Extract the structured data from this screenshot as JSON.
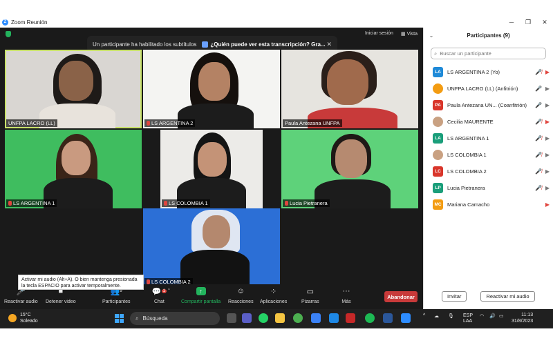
{
  "window": {
    "title": "Zoom Reunión"
  },
  "top_right": {
    "signin": "Iniciar sesión",
    "view": "Vista"
  },
  "banner": {
    "message": "Un participante ha habilitado los subtítulos",
    "link": "¿Quién puede ver esta transcripción? Gra..."
  },
  "tiles": [
    {
      "name": "UNFPA LACRO (LL)"
    },
    {
      "name": "LS ARGENTINA 2"
    },
    {
      "name": "Paula Antezana UNFPA"
    },
    {
      "name": "LS ARGENTINA 1"
    },
    {
      "name": "LS COLOMBIA 1"
    },
    {
      "name": "Lucia Pietranera"
    },
    {
      "name": "LS COLOMBIA 2"
    }
  ],
  "tooltip": "Activar mi audio (Alt+A). O bien mantenga presionada la tecla ESPACIO para activar temporalmente.",
  "toolbar": {
    "unmute": "Reactivar audio",
    "video": "Detener video",
    "participants": "Participantes",
    "participants_count": "9",
    "chat": "Chat",
    "chat_badge": "1",
    "share": "Compartir pantalla",
    "reactions": "Reacciones",
    "apps": "Aplicaciones",
    "whiteboards": "Pizarras",
    "more": "Más",
    "end": "Abandonar"
  },
  "panel": {
    "title": "Participantes (9)",
    "search_placeholder": "Buscar un participante",
    "participants": [
      {
        "initials": "LA",
        "color": "#1f8ad8",
        "name": "LS ARGENTINA 2 (Yo)",
        "mic": "muted",
        "video": "off"
      },
      {
        "initials": "",
        "color": "#f39c12",
        "name": "UNFPA LACRO (LL) (Anfitrión)",
        "mic": "on",
        "video": "on"
      },
      {
        "initials": "PA",
        "color": "#d9362b",
        "name": "Paula Antezana UN... (Coanfitrión)",
        "mic": "on",
        "video": "on"
      },
      {
        "initials": "",
        "color": "#c9a182",
        "name": "Cecilia MAURENTE",
        "mic": "muted",
        "video": "off"
      },
      {
        "initials": "LA",
        "color": "#1a9e7a",
        "name": "LS ARGENTINA 1",
        "mic": "muted",
        "video": "on"
      },
      {
        "initials": "",
        "color": "#c9a182",
        "name": "LS COLOMBIA 1",
        "mic": "muted",
        "video": "on"
      },
      {
        "initials": "LC",
        "color": "#d9362b",
        "name": "LS COLOMBIA 2",
        "mic": "muted",
        "video": "on"
      },
      {
        "initials": "LP",
        "color": "#1a9e7a",
        "name": "Lucia Pietranera",
        "mic": "muted",
        "video": "on"
      },
      {
        "initials": "MC",
        "color": "#f39c12",
        "name": "Mariana Camacho",
        "mic": "",
        "video": "off"
      }
    ],
    "invite": "Invitar",
    "unmute_me": "Reactivar mi audio"
  },
  "taskbar": {
    "temp": "15°C",
    "weather": "Soleado",
    "search": "Búsqueda",
    "lang1": "ESP",
    "lang2": "LAA",
    "time": "11:13",
    "date": "31/8/2023"
  }
}
